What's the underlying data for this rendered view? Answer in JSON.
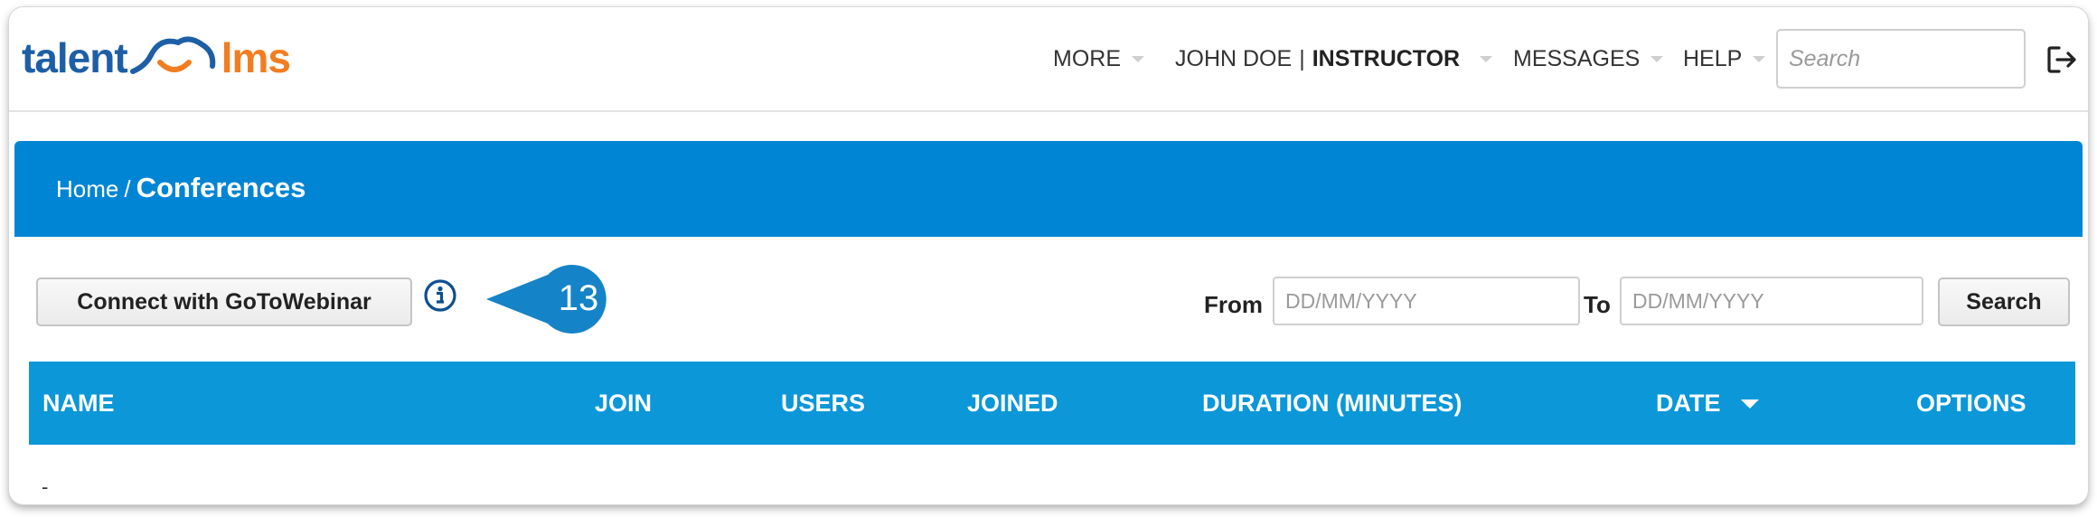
{
  "brand": {
    "logo_left": "talent",
    "logo_right": "lms",
    "primary_color": "#0085d5",
    "logo_blue": "#1d5fa6",
    "logo_orange": "#f27d21"
  },
  "nav": {
    "more": "MORE",
    "user_name": "JOHN DOE",
    "user_sep": "|",
    "user_role": "INSTRUCTOR",
    "messages": "MESSAGES",
    "help": "HELP",
    "search_placeholder": "Search",
    "logout_icon": "logout-icon"
  },
  "breadcrumb": {
    "home": "Home",
    "separator": "/",
    "current": "Conferences"
  },
  "controls": {
    "connect_button": "Connect with GoToWebinar",
    "info_icon": "info-icon",
    "callout_number": "13",
    "from_label": "From",
    "from_placeholder": "DD/MM/YYYY",
    "to_label": "To",
    "to_placeholder": "DD/MM/YYYY",
    "search_button": "Search"
  },
  "table": {
    "columns": {
      "name": "NAME",
      "join": "JOIN",
      "users": "USERS",
      "joined": "JOINED",
      "duration": "DURATION (MINUTES)",
      "date": "DATE",
      "options": "OPTIONS"
    },
    "sorted_by": "date",
    "sort_direction": "descending",
    "empty_text": "-"
  }
}
